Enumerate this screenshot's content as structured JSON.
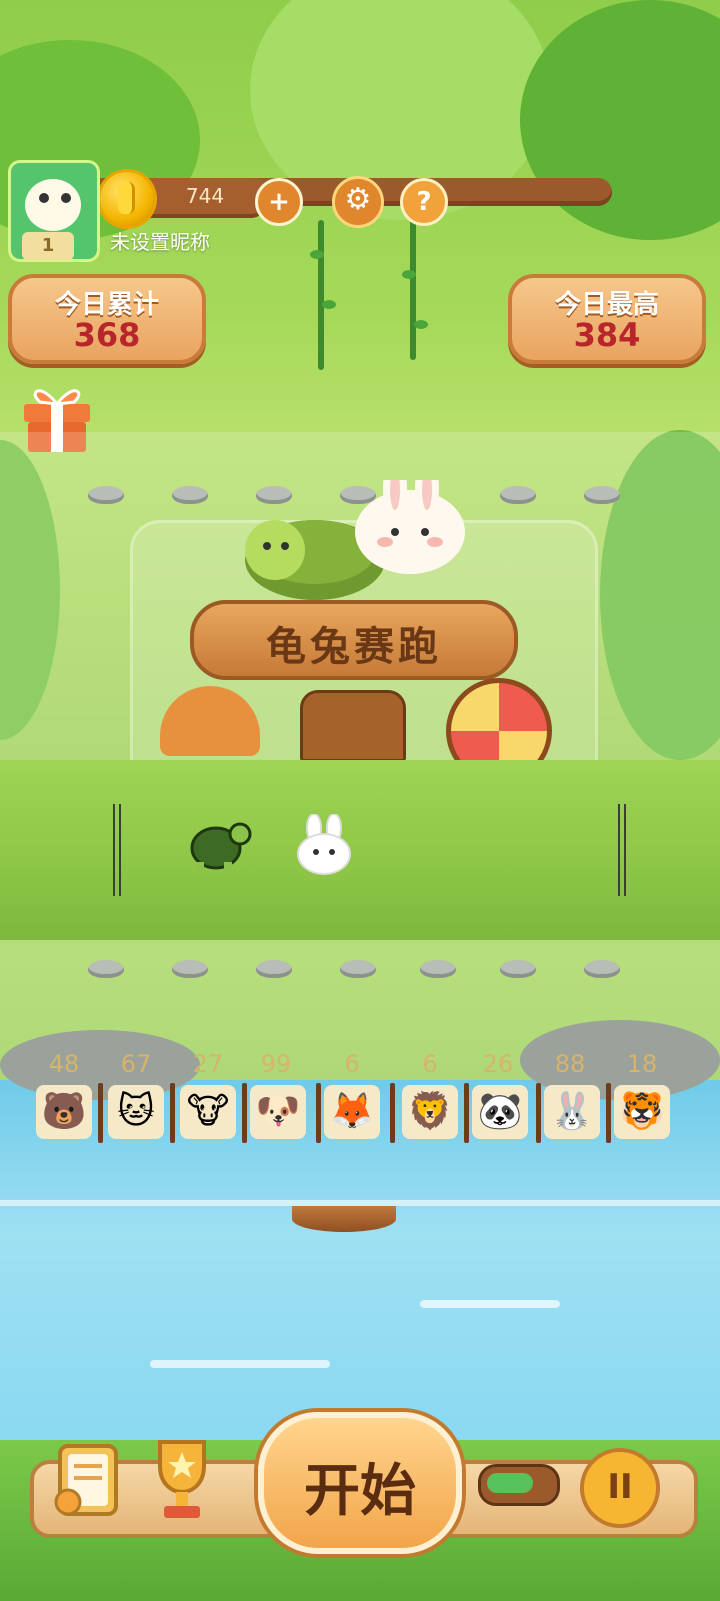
{
  "header": {
    "coins": "744",
    "nickname": "未设置昵称",
    "level": "1"
  },
  "scores": {
    "today_total_label": "今日累计",
    "today_total_value": "368",
    "today_high_label": "今日最高",
    "today_high_value": "384"
  },
  "game": {
    "title": "龟兔赛跑"
  },
  "animals": [
    {
      "name": "bear",
      "count": "48",
      "glyph": "🐻"
    },
    {
      "name": "cat",
      "count": "67",
      "glyph": "🐱"
    },
    {
      "name": "cow",
      "count": "27",
      "glyph": "🐮"
    },
    {
      "name": "dog",
      "count": "99",
      "glyph": "🐶"
    },
    {
      "name": "fox",
      "count": "6",
      "glyph": "🦊"
    },
    {
      "name": "lion",
      "count": "6",
      "glyph": "🦁"
    },
    {
      "name": "panda",
      "count": "26",
      "glyph": "🐼"
    },
    {
      "name": "rabbit",
      "count": "88",
      "glyph": "🐰"
    },
    {
      "name": "tiger",
      "count": "18",
      "glyph": "🐯"
    }
  ],
  "bottom": {
    "start_label": "开始",
    "pause_label": "II"
  },
  "icons": {
    "plus": "+",
    "gear": "⚙",
    "help": "?"
  }
}
